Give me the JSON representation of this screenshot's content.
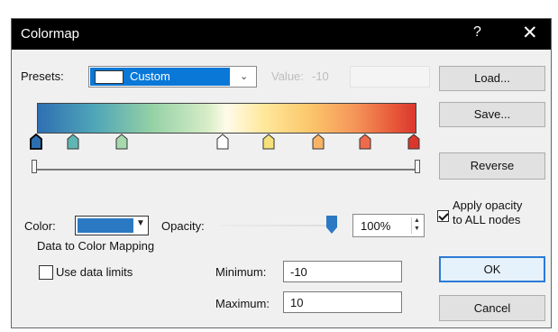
{
  "window": {
    "title": "Colormap",
    "help": "?",
    "close": "✕"
  },
  "presets": {
    "label": "Presets:",
    "selected": "Custom"
  },
  "value": {
    "label": "Value:",
    "text": "-10"
  },
  "buttons": {
    "load": "Load...",
    "save": "Save...",
    "reverse": "Reverse",
    "ok": "OK",
    "cancel": "Cancel"
  },
  "colormap": {
    "nodes": [
      {
        "color": "#2b6fae",
        "selected": true
      },
      {
        "color": "#5fb6b3",
        "selected": false
      },
      {
        "color": "#a6d9ad",
        "selected": false
      },
      {
        "color": "#ffffff",
        "selected": false
      },
      {
        "color": "#f5e07a",
        "selected": false
      },
      {
        "color": "#f7b466",
        "selected": false
      },
      {
        "color": "#ee6a4a",
        "selected": false
      },
      {
        "color": "#d9372e",
        "selected": false
      }
    ]
  },
  "color": {
    "label": "Color:",
    "value": "#2b79c3"
  },
  "opacity": {
    "label": "Opacity:",
    "value": "100%"
  },
  "apply_opacity": {
    "line1": "Apply opacity",
    "line2": "to ALL nodes",
    "checked": true
  },
  "mapping": {
    "heading": "Data to Color Mapping",
    "use_limits_label": "Use data limits",
    "use_limits_checked": false,
    "minimum_label": "Minimum:",
    "minimum_value": "-10",
    "maximum_label": "Maximum:",
    "maximum_value": "10"
  }
}
